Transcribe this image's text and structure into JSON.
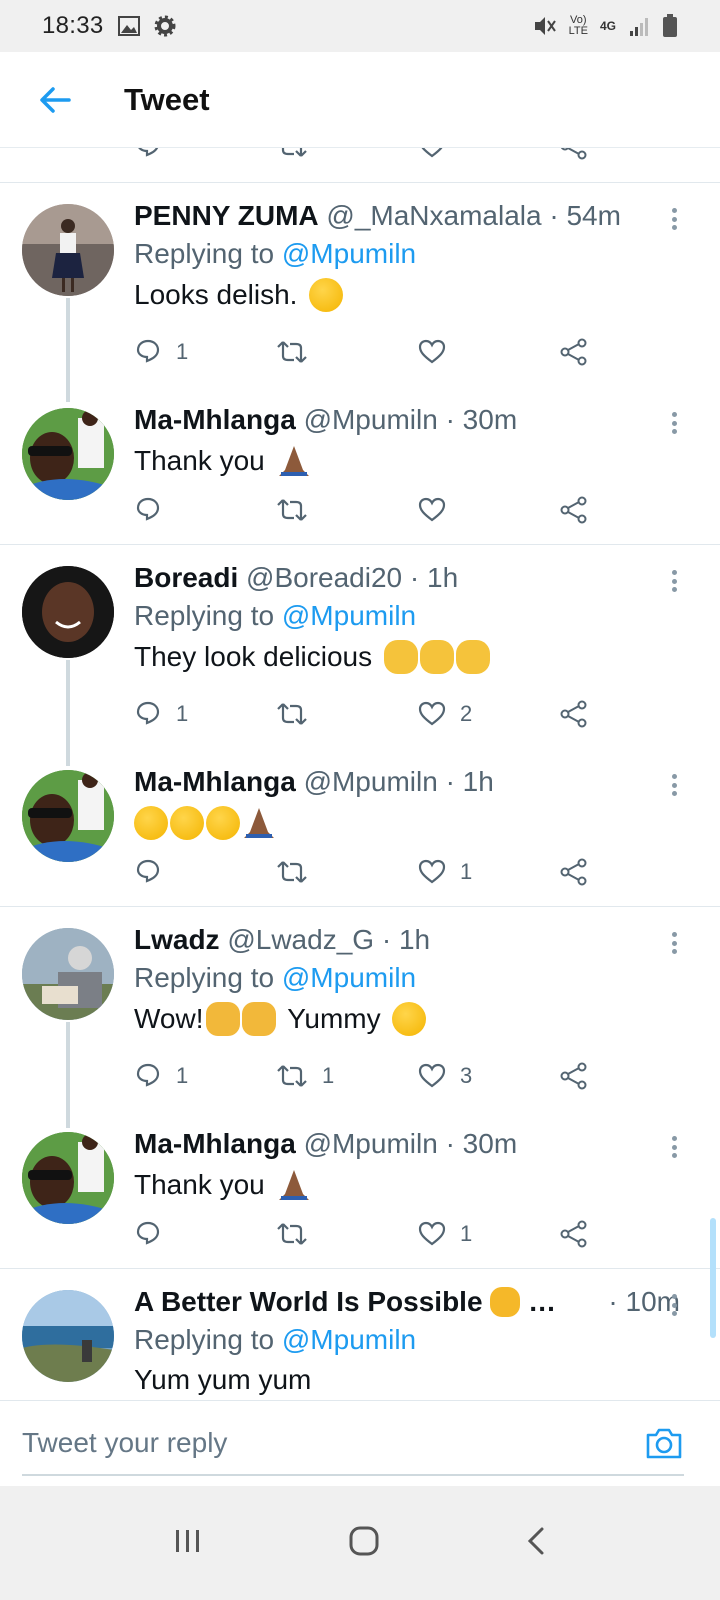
{
  "status_bar": {
    "time": "18:33",
    "net_top": "Vo)",
    "net_bottom": "LTE",
    "gen": "4G"
  },
  "header": {
    "title": "Tweet"
  },
  "tweets": [
    {
      "name": "PENNY ZUMA",
      "handle": "@_MaNxamalala",
      "time": "· 54m",
      "replying_prefix": "Replying to",
      "replying_to": "@Mpumiln",
      "text": "Looks delish.",
      "emoji": "yum",
      "replies": "1",
      "retweets": "",
      "likes": ""
    },
    {
      "name": "Ma-Mhlanga",
      "handle": "@Mpumiln",
      "time": "· 30m",
      "text": "Thank you",
      "emoji": "pray",
      "replies": "",
      "retweets": "",
      "likes": ""
    },
    {
      "name": "Boreadi",
      "handle": "@Boreadi20",
      "time": "· 1h",
      "replying_prefix": "Replying to",
      "replying_to": "@Mpumiln",
      "text": "They look delicious",
      "emoji": "ok-x3",
      "replies": "1",
      "retweets": "",
      "likes": "2"
    },
    {
      "name": "Ma-Mhlanga",
      "handle": "@Mpumiln",
      "time": "· 1h",
      "text": "",
      "emoji": "yum-x3-pray",
      "replies": "",
      "retweets": "",
      "likes": "1"
    },
    {
      "name": "Lwadz",
      "handle": "@Lwadz_G",
      "time": "· 1h",
      "replying_prefix": "Replying to",
      "replying_to": "@Mpumiln",
      "text": "Wow!",
      "text2": "Yummy",
      "emoji": "clap-x2-yum",
      "replies": "1",
      "retweets": "1",
      "likes": "3"
    },
    {
      "name": "Ma-Mhlanga",
      "handle": "@Mpumiln",
      "time": "· 30m",
      "text": "Thank you",
      "emoji": "pray",
      "replies": "",
      "retweets": "",
      "likes": "1"
    },
    {
      "name": "A Better World Is Possible",
      "name_suffix": "…",
      "handle": "",
      "time": "· 10m",
      "replying_prefix": "Replying to",
      "replying_to": "@Mpumiln",
      "text": "Yum yum yum",
      "emoji": "fist"
    }
  ],
  "reply_bar": {
    "placeholder": "Tweet your reply"
  },
  "colors": {
    "accent": "#1d9bf0",
    "muted": "#536471",
    "divider": "#e1e8ed"
  }
}
